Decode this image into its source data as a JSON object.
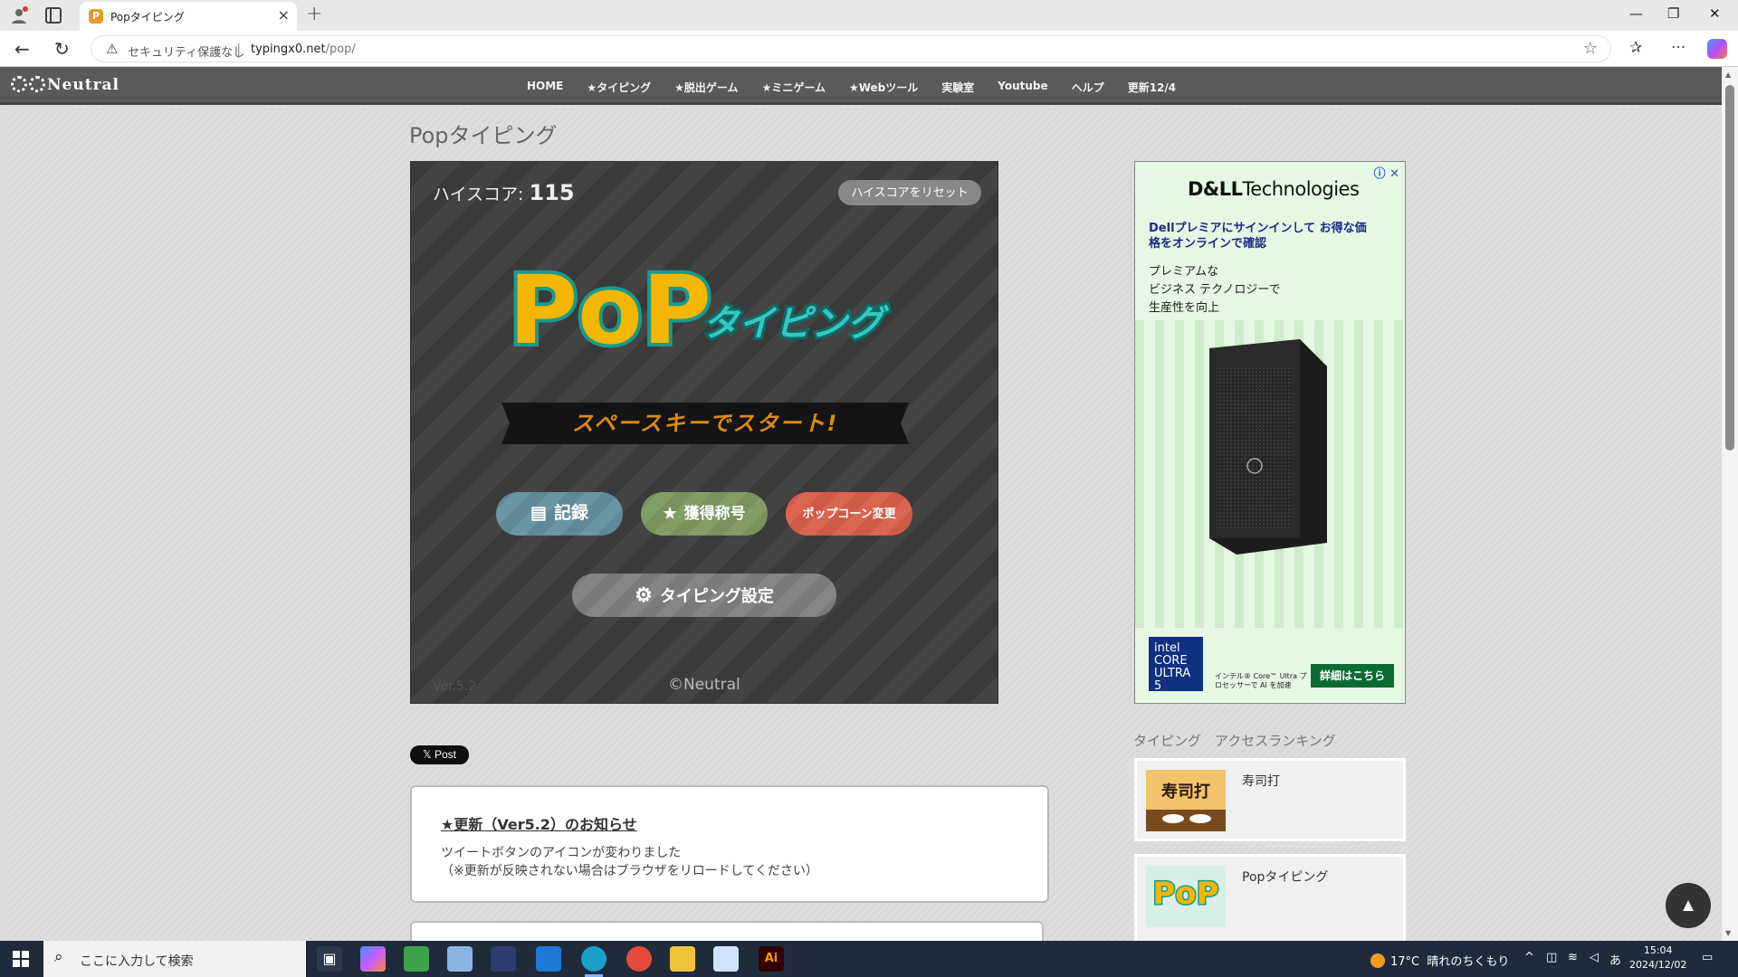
{
  "browser": {
    "tab_title": "Popタイピング",
    "tab_favicon": "P",
    "security_label": "セキュリティ保護なし",
    "url_host": "typingx0.net",
    "url_path": "/pop/"
  },
  "site": {
    "logo": "Neutral",
    "nav": [
      "HOME",
      "★タイピング",
      "★脱出ゲーム",
      "★ミニゲーム",
      "★Webツール",
      "実験室",
      "Youtube",
      "ヘルプ",
      "更新12/4"
    ]
  },
  "page": {
    "title": "Popタイピング"
  },
  "game": {
    "highscore_label": "ハイスコア:",
    "highscore_value": "115",
    "reset_button": "ハイスコアをリセット",
    "logo_pop": "PoP",
    "logo_typing": "タイピング",
    "start_prompt": "スペースキーでスタート!",
    "buttons": {
      "record": "記録",
      "titles": "獲得称号",
      "popcorn": "ポップコーン変更",
      "settings": "タイピング設定"
    },
    "version": "Ver.5.2",
    "copyright": "©Neutral"
  },
  "share": {
    "x_post": "𝕏 Post"
  },
  "news": {
    "heading": "★更新（Ver5.2）のお知らせ",
    "line1": "ツイートボタンのアイコンが変わりました",
    "line2": "（※更新が反映されない場合はブラウザをリロードしてください）"
  },
  "ad": {
    "brand_bold": "D&LL",
    "brand_rest": "Technologies",
    "headline": "Dellプレミアにサインインして お得な価格をオンラインで確認",
    "sub1": "プレミアムな",
    "sub2": "ビジネス テクノロジーで",
    "sub3": "生産性を向上",
    "intel_badge": "intel CORE ULTRA 5",
    "intel_text": "インテル® Core™ Ultra プロセッサーで AI を加速",
    "cta": "詳細はこちら",
    "close": "ⓘ ✕"
  },
  "ranking": {
    "heading": "タイピング　アクセスランキング",
    "items": [
      {
        "name": "寿司打",
        "thumb_text": "寿司打"
      },
      {
        "name": "Popタイピング",
        "thumb_text": "PoP"
      }
    ]
  },
  "back_to_top": "▲",
  "taskbar": {
    "search_placeholder": "ここに入力して検索",
    "weather_temp": "17°C",
    "weather_text": "晴れのちくもり",
    "ime": "あ",
    "time": "15:04",
    "date": "2024/12/02"
  },
  "colors": {
    "accent_brand": "#e59a2a",
    "site_header": "#5a5a5a",
    "ad_cta": "#0b6b36"
  }
}
